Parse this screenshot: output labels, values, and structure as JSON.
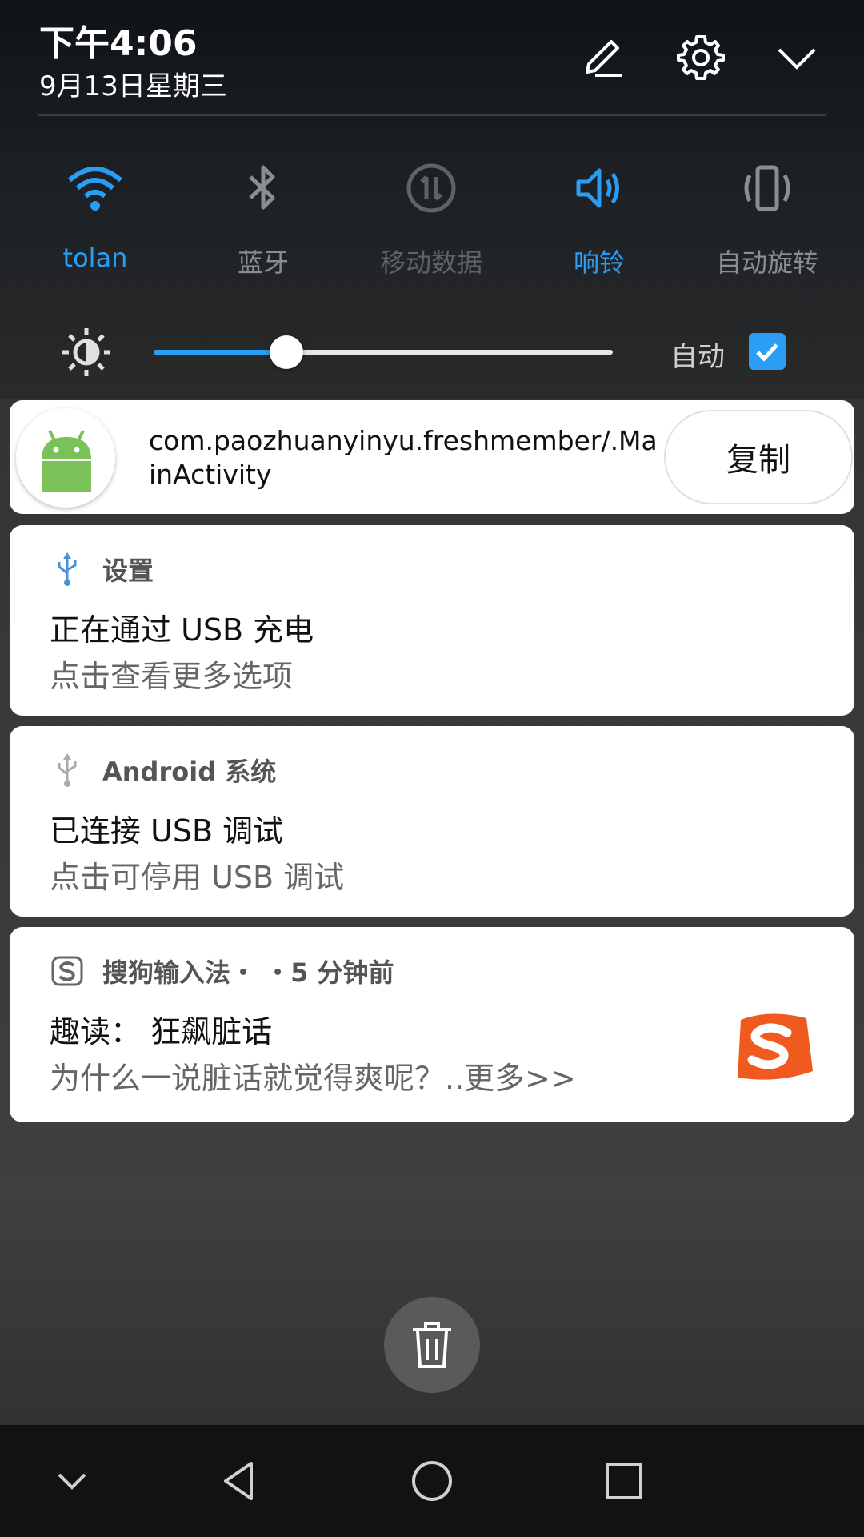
{
  "status": {
    "time": "下午4:06",
    "date": "9月13日星期三"
  },
  "header_icons": {
    "edit": "pencil-icon",
    "settings": "gear-icon",
    "collapse": "chevron-down-icon"
  },
  "quick_settings": [
    {
      "label": "tolan",
      "icon": "wifi-icon",
      "state": "on"
    },
    {
      "label": "蓝牙",
      "icon": "bluetooth-icon",
      "state": "off"
    },
    {
      "label": "移动数据",
      "icon": "mobile-data-icon",
      "state": "disabled"
    },
    {
      "label": "响铃",
      "icon": "ring-volume-icon",
      "state": "on"
    },
    {
      "label": "自动旋转",
      "icon": "auto-rotate-icon",
      "state": "off"
    }
  ],
  "brightness": {
    "level": 0.29,
    "auto_label": "自动",
    "auto_checked": true
  },
  "activity_card": {
    "text": "com.paozhuanyinyu.freshmember/.MainActivity",
    "button": "复制"
  },
  "notifications": [
    {
      "app": "设置",
      "title": "正在通过 USB 充电",
      "text": "点击查看更多选项",
      "icon": "usb-icon"
    },
    {
      "app": "Android 系统",
      "title": "已连接 USB 调试",
      "text": "点击可停用 USB 调试",
      "icon": "usb-icon"
    },
    {
      "app": "搜狗输入法・ ・5 分钟前",
      "title": "趣读：  狂飙脏话",
      "text": "为什么一说脏话就觉得爽呢？..更多>>",
      "icon": "sogou-icon"
    }
  ],
  "colors": {
    "accent": "#2a9df4",
    "shade": "#1b1f24",
    "card": "#ffffff",
    "sogou": "#f05a1e"
  }
}
